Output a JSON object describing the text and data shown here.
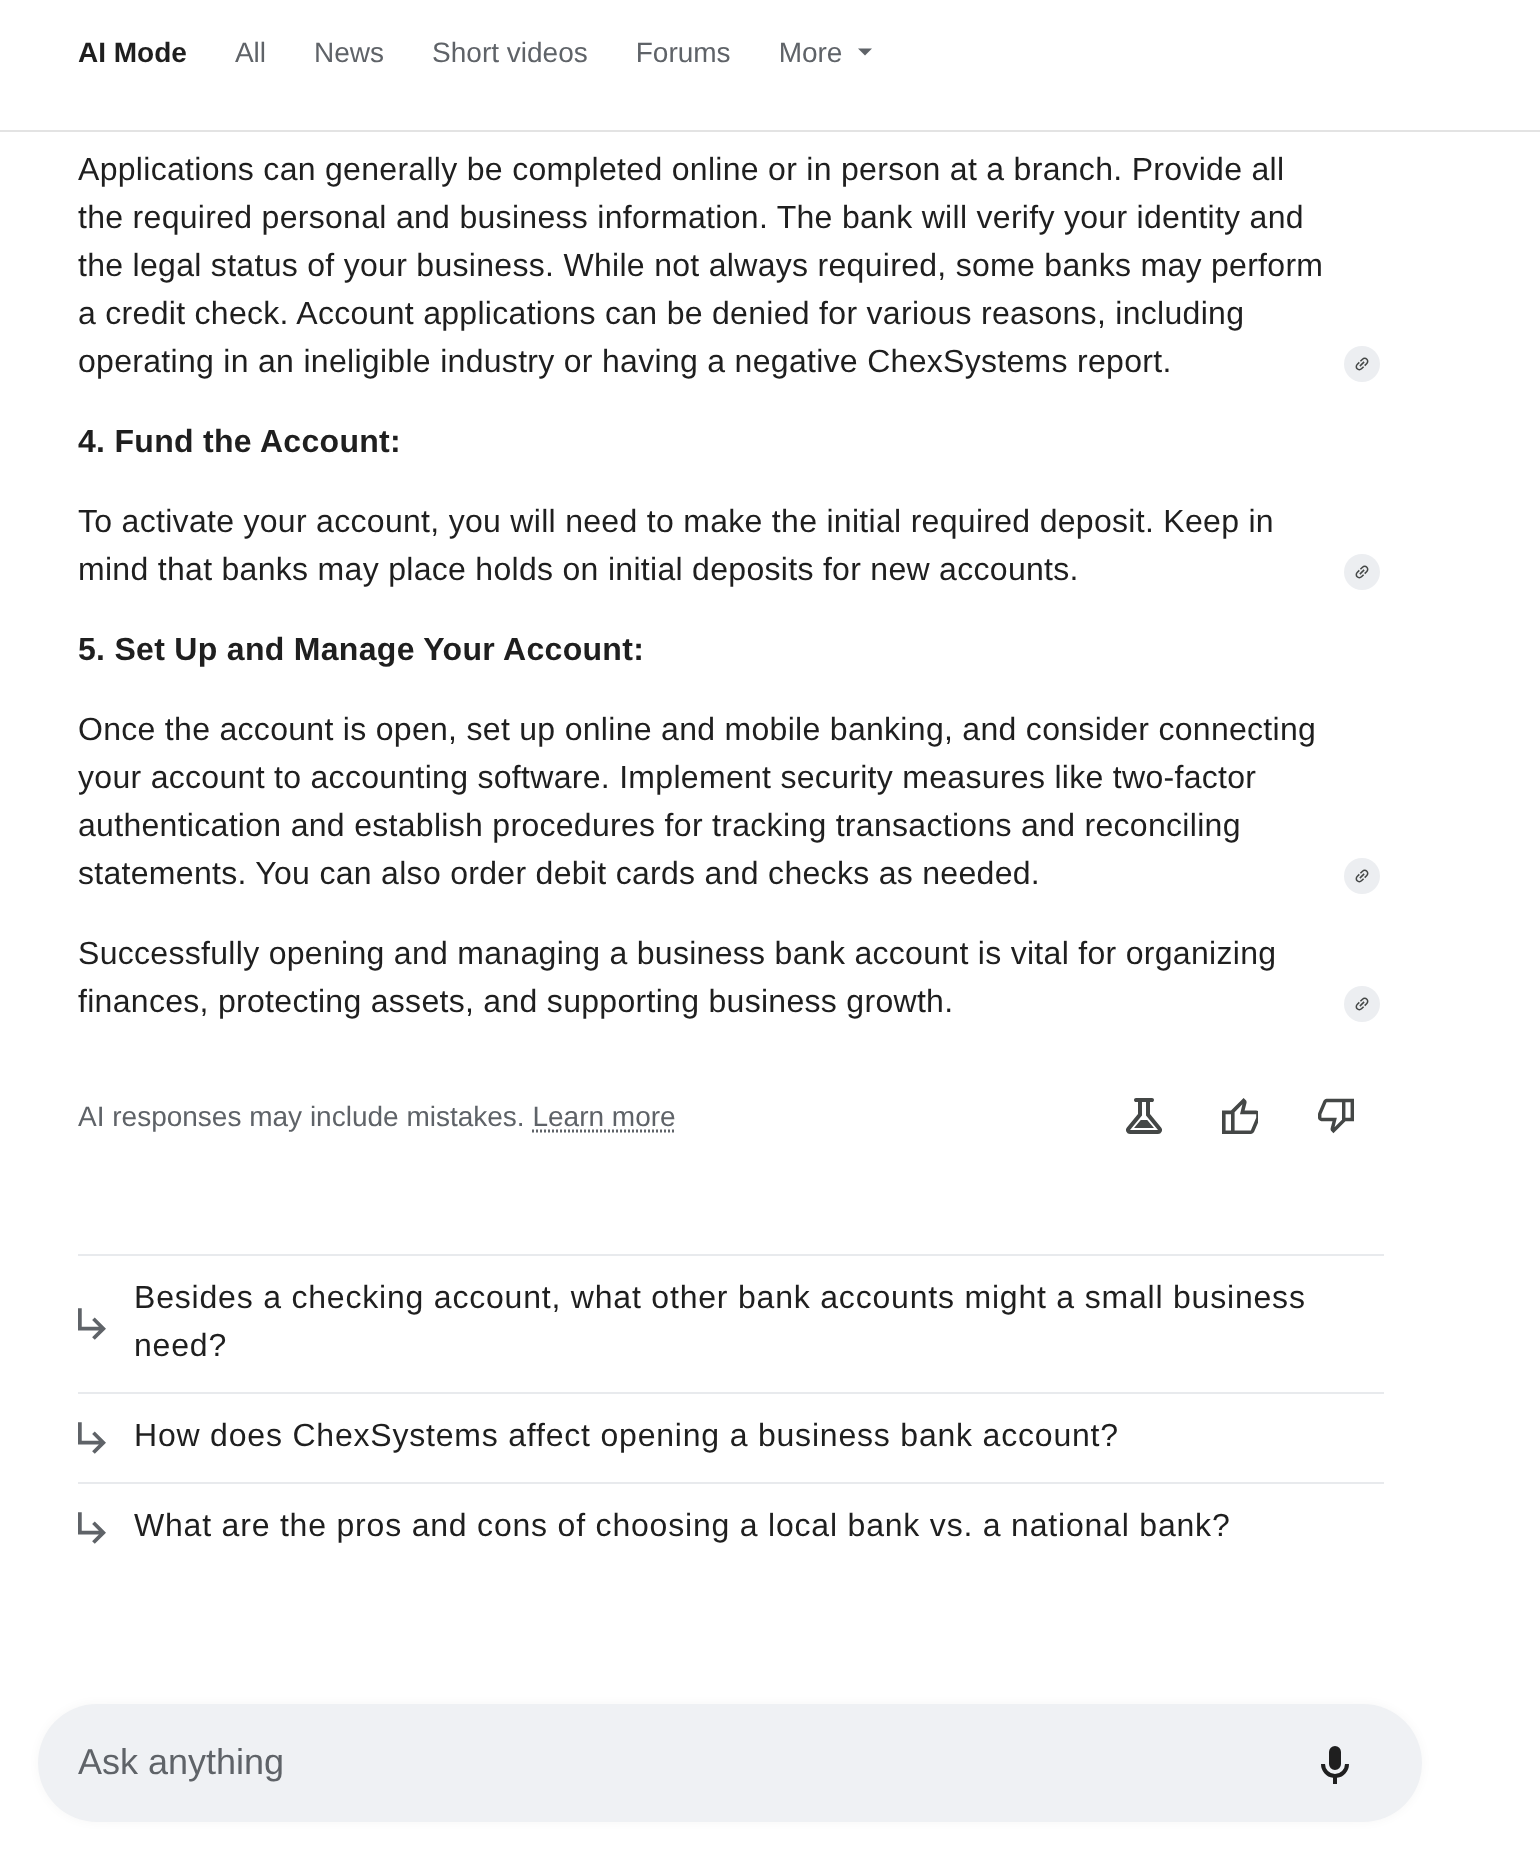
{
  "tabs": [
    {
      "label": "AI Mode",
      "selected": true,
      "kind": "tab"
    },
    {
      "label": "All",
      "selected": false,
      "kind": "tab"
    },
    {
      "label": "News",
      "selected": false,
      "kind": "tab"
    },
    {
      "label": "Short videos",
      "selected": false,
      "kind": "tab"
    },
    {
      "label": "Forums",
      "selected": false,
      "kind": "tab"
    },
    {
      "label": "More",
      "selected": false,
      "kind": "dropdown"
    }
  ],
  "answer": {
    "blocks": [
      {
        "kind": "paragraph",
        "text": "Applications can generally be completed online or in person at a branch. Provide all the required personal and business information. The bank will verify your identity and the legal status of your business. While not always required, some banks may perform a credit check. Account applications can be denied for various reasons, including operating in an ineligible industry or having a negative ChexSystems report.",
        "link": true
      },
      {
        "kind": "heading",
        "text": "4. Fund the Account:"
      },
      {
        "kind": "paragraph",
        "text": "To activate your account, you will need to make the initial required deposit. Keep in mind that banks may place holds on initial deposits for new accounts.",
        "link": true
      },
      {
        "kind": "heading",
        "text": "5. Set Up and Manage Your Account:"
      },
      {
        "kind": "paragraph",
        "text": "Once the account is open, set up online and mobile banking, and consider connecting your account to accounting software. Implement security measures like two-factor authentication and establish procedures for tracking transactions and reconciling statements. You can also order debit cards and checks as needed.",
        "link": true
      },
      {
        "kind": "paragraph",
        "text": "Successfully opening and managing a business bank account is vital for organizing finances, protecting assets, and supporting business growth.",
        "link": true
      }
    ]
  },
  "disclaimer": {
    "text": "AI responses may include mistakes.",
    "link": "Learn more"
  },
  "follow_ups": [
    "Besides a checking account, what other bank accounts might a small business need?",
    "How does ChexSystems affect opening a business bank account?",
    "What are the pros and cons of choosing a local bank vs. a national bank?"
  ],
  "ask_field": {
    "placeholder": "Ask anything"
  }
}
